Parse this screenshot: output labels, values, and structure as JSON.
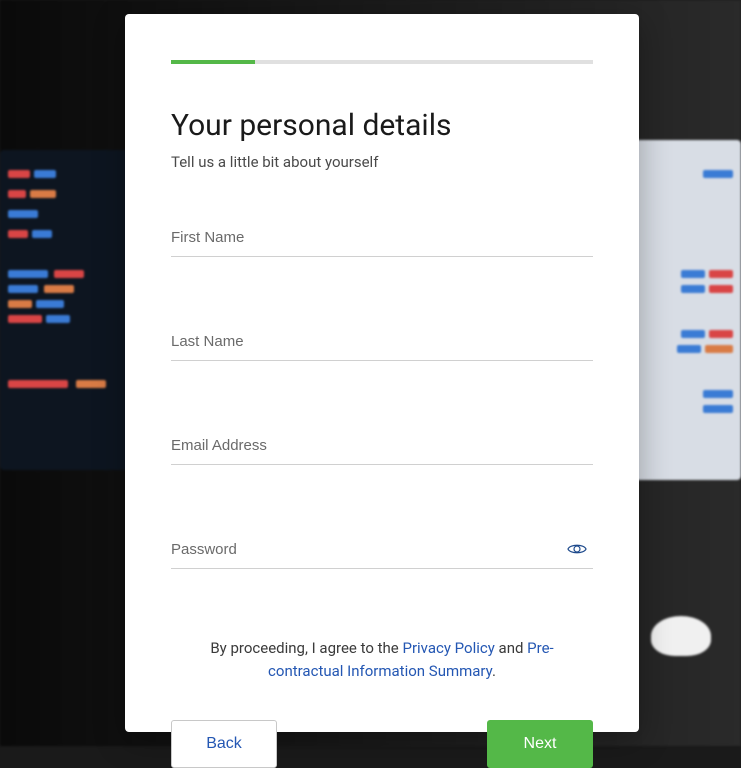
{
  "progress": {
    "percent": 20
  },
  "heading": "Your personal details",
  "subheading": "Tell us a little bit about yourself",
  "fields": {
    "firstName": {
      "placeholder": "First Name",
      "value": ""
    },
    "lastName": {
      "placeholder": "Last Name",
      "value": ""
    },
    "email": {
      "placeholder": "Email Address",
      "value": ""
    },
    "password": {
      "placeholder": "Password",
      "value": ""
    }
  },
  "consent": {
    "prefix": "By proceeding, I agree to the ",
    "privacyPolicy": "Privacy Policy",
    "mid": " and ",
    "preContractual": "Pre-contractual Information Summary",
    "suffix": "."
  },
  "buttons": {
    "back": "Back",
    "next": "Next"
  }
}
